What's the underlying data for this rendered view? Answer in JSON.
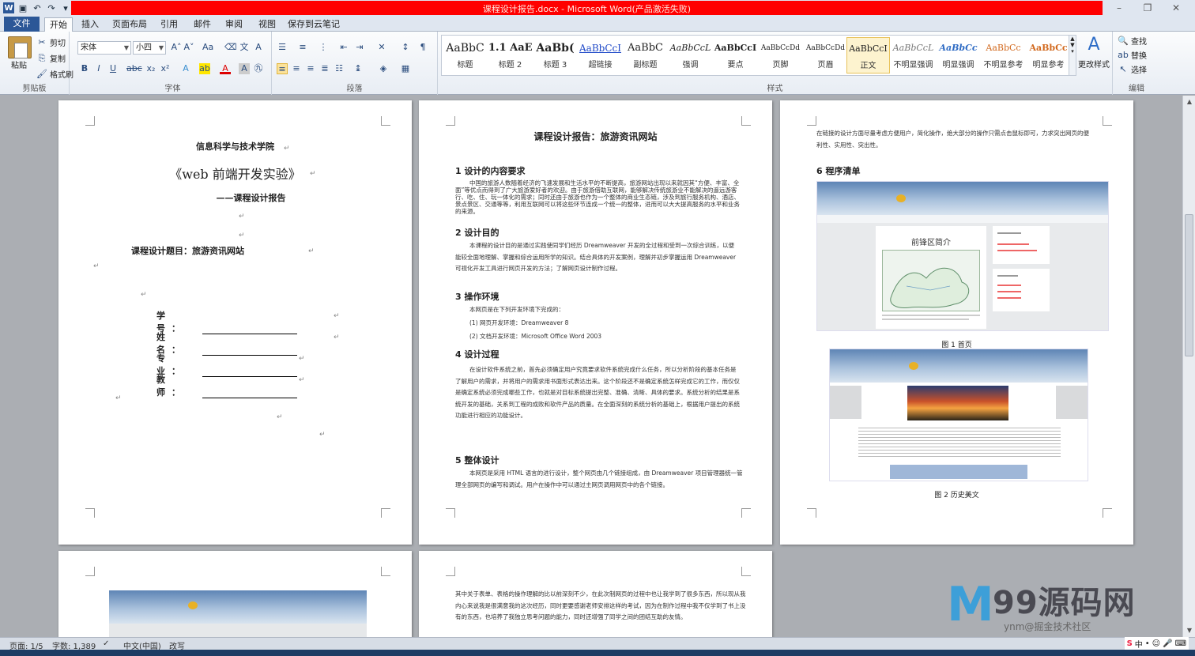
{
  "window": {
    "title": "课程设计报告.docx - Microsoft Word(产品激活失败)"
  },
  "tabs": [
    "文件",
    "开始",
    "插入",
    "页面布局",
    "引用",
    "邮件",
    "审阅",
    "视图",
    "保存到云笔记"
  ],
  "ribbon": {
    "clipboard": {
      "paste": "粘贴",
      "cut": "剪切",
      "copy": "复制",
      "format_painter": "格式刷",
      "label": "剪贴板"
    },
    "font": {
      "name": "宋体",
      "size": "小四",
      "label": "字体"
    },
    "paragraph": {
      "label": "段落"
    },
    "styles": {
      "label": "样式",
      "items": [
        {
          "sample": "AaBbC",
          "name": "标题"
        },
        {
          "sample": "1.1 AaE",
          "name": "标题 2"
        },
        {
          "sample": "AaBb(",
          "name": "标题 3"
        },
        {
          "sample": "AaBbCcI",
          "name": "超链接"
        },
        {
          "sample": "AaBbC",
          "name": "副标题"
        },
        {
          "sample": "AaBbCcL",
          "name": "强调"
        },
        {
          "sample": "AaBbCcI",
          "name": "要点"
        },
        {
          "sample": "AaBbCcDd",
          "name": "页脚"
        },
        {
          "sample": "AaBbCcDd",
          "name": "页眉"
        },
        {
          "sample": "AaBbCcI",
          "name": "正文"
        },
        {
          "sample": "AaBbCcL",
          "name": "不明显强调"
        },
        {
          "sample": "AaBbCc",
          "name": "明显强调"
        },
        {
          "sample": "AaBbCc",
          "name": "不明显参考"
        },
        {
          "sample": "AaBbCc",
          "name": "明显参考"
        }
      ],
      "change_styles": "更改样式"
    },
    "editing": {
      "find": "查找",
      "replace": "替换",
      "select": "选择",
      "label": "编辑"
    }
  },
  "page1": {
    "college": "信息科学与技术学院",
    "course": "《web 前端开发实验》",
    "subtitle": "——课程设计报告",
    "topic": "课程设计题目：旅游资讯网站",
    "fields": [
      "学  号：",
      "姓  名：",
      "专  业：",
      "教  师："
    ]
  },
  "page2": {
    "title": "课程设计报告：旅游资讯网站",
    "s1": "1 设计的内容要求",
    "s1_text": "中国的旅游人数随着经济的飞速发展和生活水平的不断提高，旅游网站出现以来就因其“方便、丰富、全面”等优点而得到了广大旅游爱好者的欢迎。由于旅游借助互联网，能够解决传统旅游业不能解决的遥远游客行、吃、住、玩一体化的需求；同时还由于旅游也作为一个整体的商业生态链，涉及到旅行服务机构、酒店、景点景区、交通等等，利用互联网可以将这些环节连成一个统一的整体，进而可以大大提高服务的水平和业务的来源。",
    "s2": "2 设计目的",
    "s2_text": "本课程的设计目的是通过实践使同学们经历 Dreamweaver 开发的全过程和受到一次综合训练，以便能较全面地理解、掌握和综合运用所学的知识。结合具体的开发案例，理解并初步掌握运用 Dreamweaver 可视化开发工具进行网页开发的方法；了解网页设计制作过程。",
    "s3": "3 操作环境",
    "s3_text": [
      "本网页是在下列开发环境下完成的：",
      "(1) 网页开发环境：Dreamweaver 8",
      "(2) 文档开发环境：Microsoft Office Word 2003"
    ],
    "s4": "4 设计过程",
    "s4_text": "在设计软件系统之前，首先必须确定用户究竟要求软件系统完成什么任务，所以分析阶段的基本任务是了解用户的需求，并将用户的需求用书面形式表达出来。这个阶段还不是确定系统怎样完成它的工作，而仅仅是确定系统必须完成哪些工作，也就是对目标系统提出完整、准确、清晰、具体的要求。系统分析的结果是系统开发的基础，关系到工程的成败和软件产品的质量。在全面深刻的系统分析的基础上，根据用户提出的系统功能进行相应的功能设计。",
    "s5": "5  整体设计",
    "s5_text": "本网页是采用 HTML 语言的进行设计，整个网页由几个链接组成，由 Dreamweaver 项目管理器统一管理全部网页的编写和调试。用户在操作中可以通过主网页调用网页中的各个链接。"
  },
  "page3": {
    "intro": "在链接的设计方面尽量考虑方便用户，简化操作，绝大部分的操作只需点击鼠标即可，力求突出网页的便利性、实用性、突出性。",
    "s6": "6 程序清单",
    "shot1_heading": "前锋区简介",
    "fig1": "图 1  首页",
    "fig2": "图 2  历史美文"
  },
  "page5": {
    "text": "其中关于表单、表格的操作理解的比以前深刻不少，在此次制网页的过程中也让我学到了很多东西，所以现从我内心来说我是很满意我的这次经历，同时更要感谢老师安排这样的考试，因为在制作过程中我不仅学到了书上没有的东西，也培养了我独立思考问题的能力，同时还增强了同学之间的团结互助的友情。"
  },
  "status": {
    "page": "页面: 1/5",
    "words": "字数: 1,389",
    "lang": "中文(中国)",
    "mode": "改写"
  },
  "watermark": {
    "logo": "M",
    "text": "99源码网",
    "sub": "ynm@掘金技术社区"
  },
  "ime": {
    "label": "中"
  }
}
